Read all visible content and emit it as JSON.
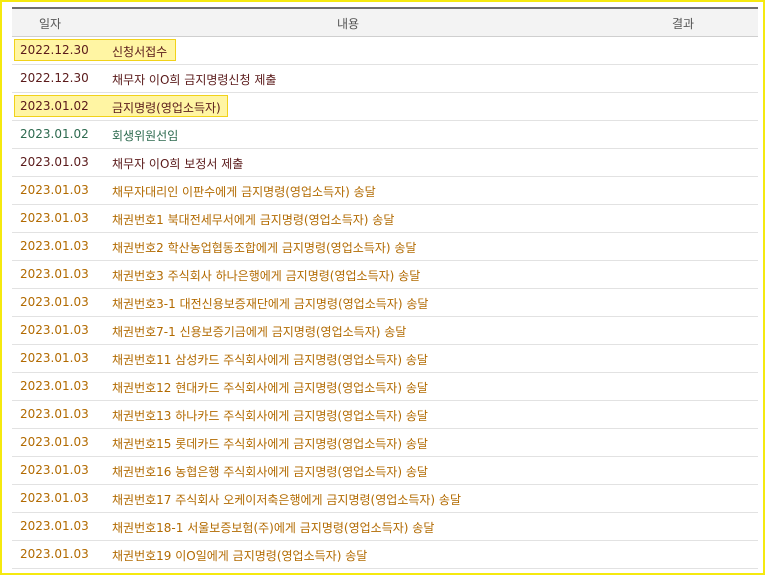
{
  "header": {
    "date": "일자",
    "content": "내용",
    "result": "결과"
  },
  "rows": [
    {
      "date": "2022.12.30",
      "content": "신청서접수",
      "color": "dark"
    },
    {
      "date": "2022.12.30",
      "content": "채무자 이O희 금지명령신청 제출",
      "color": "dark"
    },
    {
      "date": "2023.01.02",
      "content": "금지명령(영업소득자)",
      "color": "dark"
    },
    {
      "date": "2023.01.02",
      "content": "회생위원선임",
      "color": "green"
    },
    {
      "date": "2023.01.03",
      "content": "채무자 이O희 보정서 제출",
      "color": "dark"
    },
    {
      "date": "2023.01.03",
      "content": "채무자대리인 이판수에게 금지명령(영업소득자) 송달",
      "color": "orange"
    },
    {
      "date": "2023.01.03",
      "content": "채권번호1 북대전세무서에게 금지명령(영업소득자) 송달",
      "color": "orange"
    },
    {
      "date": "2023.01.03",
      "content": "채권번호2 학산농업협동조합에게 금지명령(영업소득자) 송달",
      "color": "orange"
    },
    {
      "date": "2023.01.03",
      "content": "채권번호3 주식회사 하나은행에게 금지명령(영업소득자) 송달",
      "color": "orange"
    },
    {
      "date": "2023.01.03",
      "content": "채권번호3-1 대전신용보증재단에게 금지명령(영업소득자) 송달",
      "color": "orange"
    },
    {
      "date": "2023.01.03",
      "content": "채권번호7-1 신용보증기금에게 금지명령(영업소득자) 송달",
      "color": "orange"
    },
    {
      "date": "2023.01.03",
      "content": "채권번호11 삼성카드 주식회사에게 금지명령(영업소득자) 송달",
      "color": "orange"
    },
    {
      "date": "2023.01.03",
      "content": "채권번호12 현대카드 주식회사에게 금지명령(영업소득자) 송달",
      "color": "orange"
    },
    {
      "date": "2023.01.03",
      "content": "채권번호13 하나카드 주식회사에게 금지명령(영업소득자) 송달",
      "color": "orange"
    },
    {
      "date": "2023.01.03",
      "content": "채권번호15 롯데카드 주식회사에게 금지명령(영업소득자) 송달",
      "color": "orange"
    },
    {
      "date": "2023.01.03",
      "content": "채권번호16 농협은행 주식회사에게 금지명령(영업소득자) 송달",
      "color": "orange"
    },
    {
      "date": "2023.01.03",
      "content": "채권번호17 주식회사 오케이저축은행에게 금지명령(영업소득자) 송달",
      "color": "orange"
    },
    {
      "date": "2023.01.03",
      "content": "채권번호18-1 서울보증보험(주)에게 금지명령(영업소득자) 송달",
      "color": "orange"
    },
    {
      "date": "2023.01.03",
      "content": "채권번호19 이O일에게 금지명령(영업소득자) 송달",
      "color": "orange"
    }
  ]
}
